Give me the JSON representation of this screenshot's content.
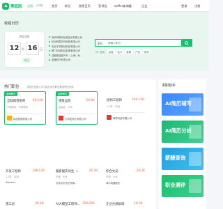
{
  "brand": {
    "name": "黑狐网",
    "color": "#19c06b"
  },
  "topnav": {
    "city": "全国",
    "switch": "[切换]",
    "items": [
      "首页",
      "职位",
      "校招日历",
      "宣讲会",
      "ooffer查询器",
      "企业"
    ],
    "login": "登录",
    "register": "注册"
  },
  "hero": {
    "title": "校招日历",
    "calendar": {
      "year": "2023年",
      "month": "12",
      "month_unit": "月",
      "day": "16",
      "day_unit": "日",
      "tag": "今日"
    },
    "feed": [
      "深圳市腾讯信息技术有限公司",
      "杭州阿里巴巴网络有限公司",
      "北京字节跳动科技有限公司",
      "厦门华迪科技发展有限公司",
      "成都新能源汽车（上海）有...",
      "金蝶软件有限公司"
    ]
  },
  "search": {
    "category": "职位",
    "placeholder": "请输入职位",
    "hot_label": "热门搜索:",
    "hot_tags": [
      "运营",
      "会计",
      "客服",
      "产品",
      "销售"
    ]
  },
  "hot_jobs": {
    "title": "热门职位",
    "subtitle": "当前在全国人才门槛业务员职位薪资职位在线",
    "cards": [
      {
        "tag": "急聘职位",
        "title": "互联网营销师",
        "salary": "5K-10K",
        "req": "不限经验 · 不限学历",
        "company": "瑞信盈通有限公司",
        "logo_color": "#ffb300"
      },
      {
        "tag": "急聘职位",
        "title": "销售运营",
        "salary": "4K-6K",
        "req": "应届生 · 大专",
        "company": "大润发商业有限公司",
        "logo_color": "#e53935"
      },
      {
        "tag": "",
        "title": "结构工程师",
        "salary": "10K-15K",
        "req": "1-3年 · 本科",
        "company": "海思科技有限公司",
        "logo_color": "#e53935"
      }
    ],
    "row2": [
      {
        "title": "开发工程师",
        "salary": "10K-12K",
        "req": "1-3年 · 本科",
        "company": "Rakuten"
      },
      {
        "title": "偏客服实训生（...",
        "salary": "2K-3K",
        "req": "不限 · 大专",
        "company": "北京京东世纪贸易..."
      },
      {
        "title": "综合文员",
        "salary": "2K-3K",
        "req": "不限 · 大专",
        "company": "海尔电器股份"
      }
    ],
    "row3": [
      {
        "title": "施工员",
        "salary": "3K-5K"
      },
      {
        "title": "AI大模型工程师...",
        "salary": "15K-20K"
      },
      {
        "title": "企业合规助理",
        "salary": "2K-3K"
      }
    ]
  },
  "side": {
    "title": "求职助手",
    "promos": [
      {
        "label": "AI简历辅写",
        "color_a": "#3a86ff",
        "color_b": "#5aa7ff"
      },
      {
        "label": "AI简历分析",
        "color_a": "#1fb873",
        "color_b": "#3ed090"
      },
      {
        "label": "薪酬查询",
        "color_a": "#1f9fe0",
        "color_b": "#41bff0"
      },
      {
        "label": "职业测评",
        "color_a": "#19c06b",
        "color_b": "#3ed090"
      }
    ]
  }
}
